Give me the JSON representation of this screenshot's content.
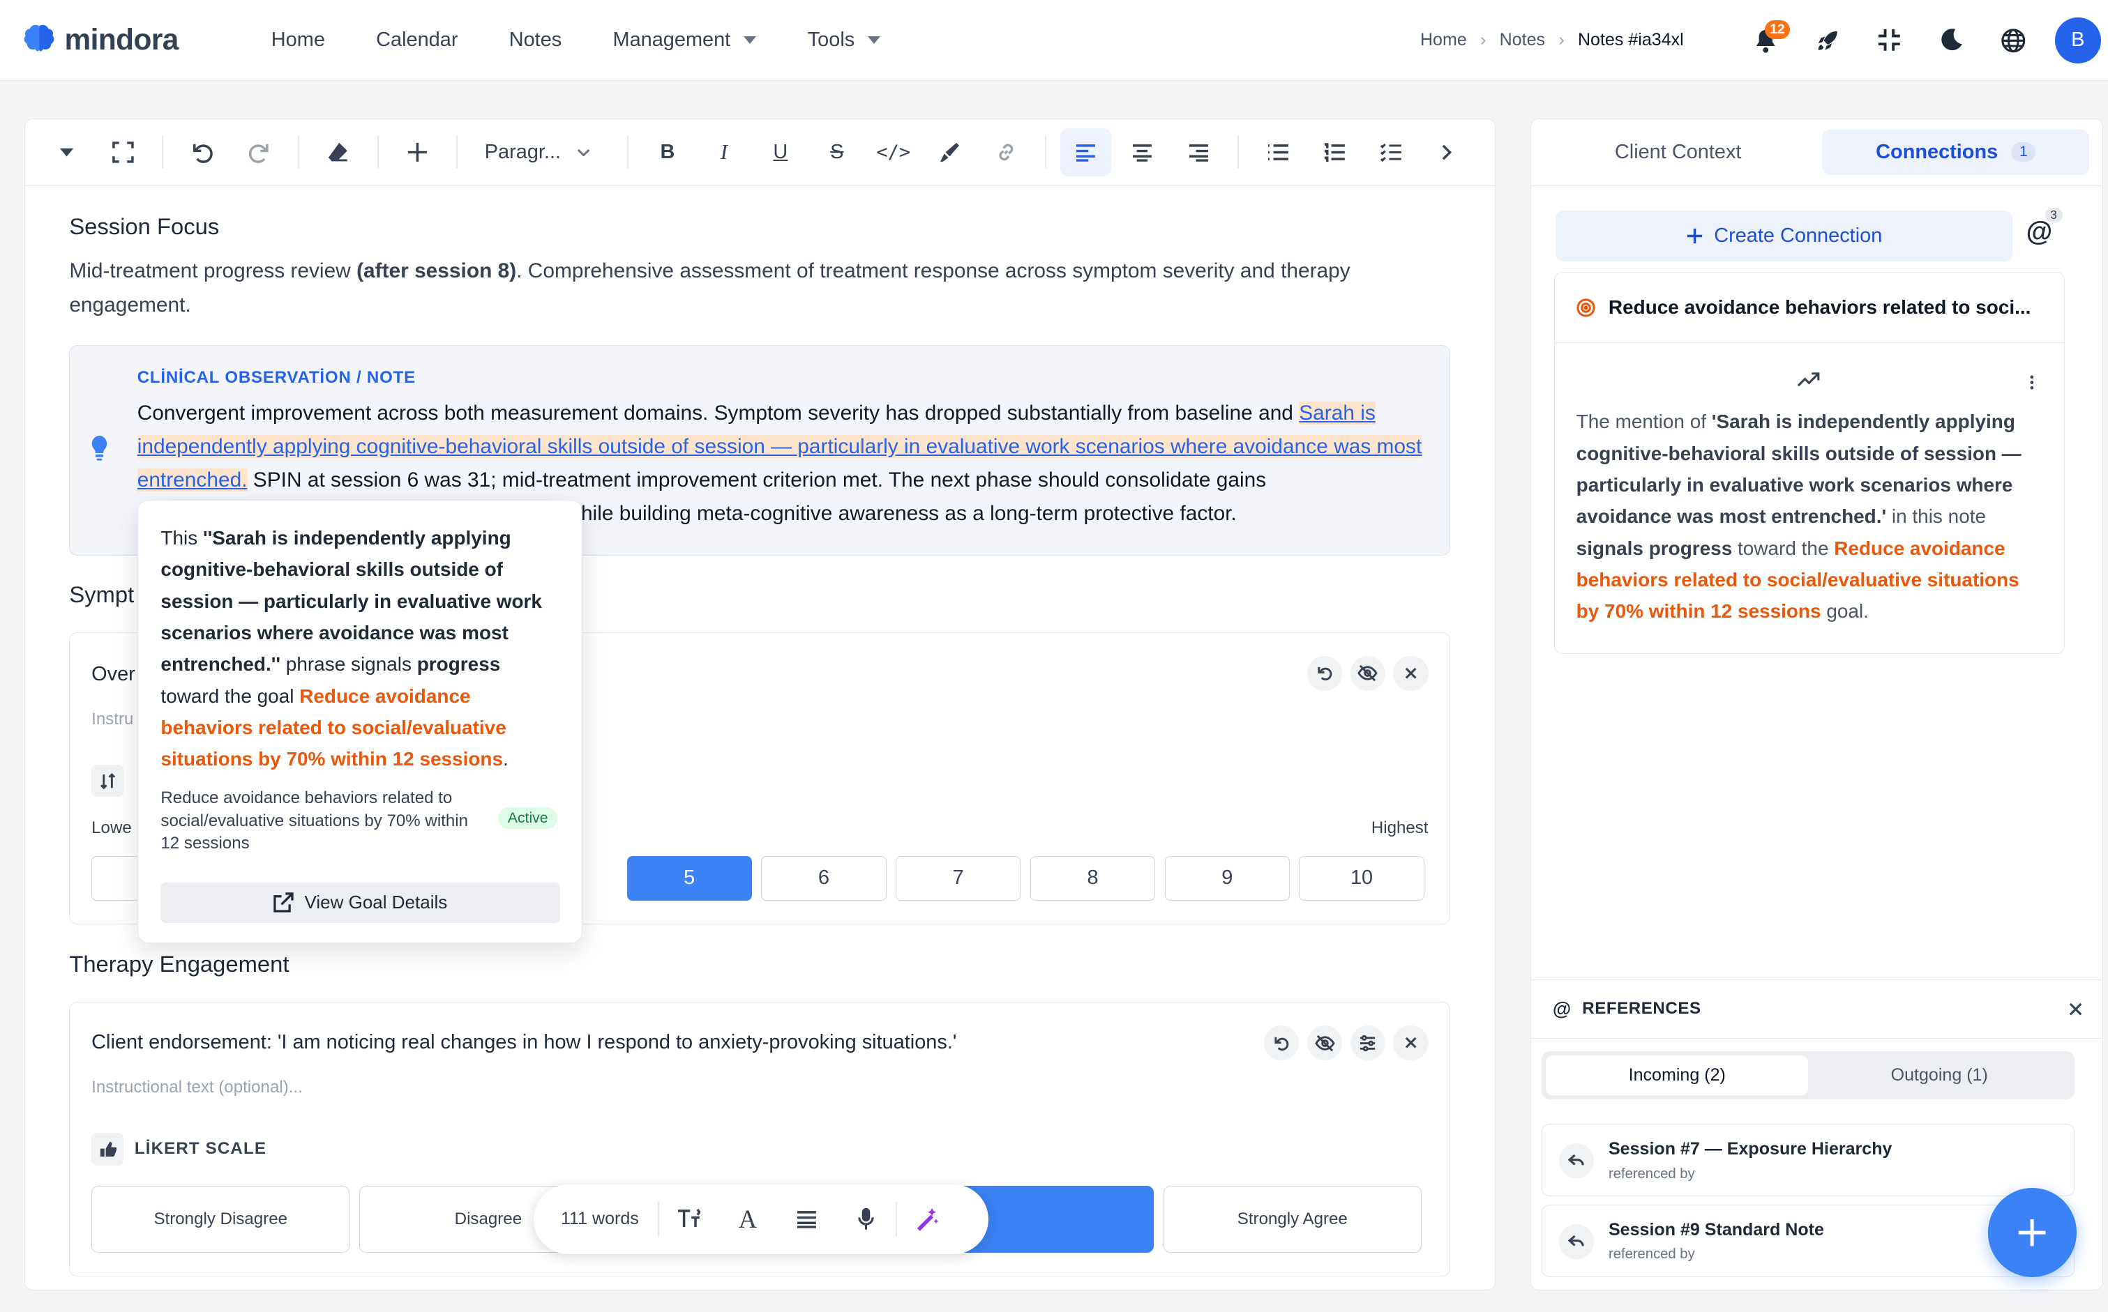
{
  "app": {
    "logo_text": "mindora"
  },
  "nav": [
    {
      "label": "Home"
    },
    {
      "label": "Calendar"
    },
    {
      "label": "Notes"
    },
    {
      "label": "Management",
      "dropdown": true
    },
    {
      "label": "Tools",
      "dropdown": true
    }
  ],
  "breadcrumb": [
    "Home",
    "Notes",
    "Notes #ia34xl"
  ],
  "header": {
    "notification_count": "12",
    "avatar_initial": "B"
  },
  "toolbar": {
    "paragraph_label": "Paragr..."
  },
  "editor": {
    "session_focus_title": "Session Focus",
    "session_focus_pre": "Mid-treatment progress review ",
    "session_focus_bold": "(after session 8)",
    "session_focus_post": ". Comprehensive assessment of treatment response across symptom severity and therapy engagement.",
    "observation": {
      "label": "CLİNİCAL OBSERVATİON / NOTE",
      "text_pre": "Convergent improvement across both measurement domains. Symptom severity has dropped substantially from baseline and ",
      "text_highlight": "Sarah is independently applying cognitive-behavioral skills outside of session — particularly in evaluative work scenarios where avoidance was most entrenched.",
      "text_post_1": " SPIN at session 6 was 31; mid-treatment improvement criterion met. The next phase should consolidate gains",
      "text_post_2": "hile building meta-cognitive awareness as a long-term protective factor."
    },
    "symptom_title_partial": "Sympt",
    "symptom_question_partial": "Over",
    "symptom_instruction_partial": "Instru",
    "scale_low_partial": "Lowe",
    "scale_high": "Highest",
    "scale_values": [
      "5",
      "6",
      "7",
      "8",
      "9",
      "10"
    ],
    "scale_selected": "5",
    "therapy_title": "Therapy Engagement",
    "therapy_question": "Client endorsement: 'I am noticing real changes in how I respond to anxiety-provoking situations.'",
    "therapy_instruction_placeholder": "Instructional text (optional)...",
    "likert_label": "LİKERT SCALE",
    "likert_options": [
      "Strongly Disagree",
      "Disagree",
      "Agree",
      "Strongly Agree"
    ],
    "likert_selected": "Agree"
  },
  "popover": {
    "prefix": "This ",
    "quote": "''Sarah is independently applying cognitive-behavioral skills outside of session — particularly in evaluative work scenarios where avoidance was most entrenched.''",
    "mid": " phrase signals ",
    "signal": "progress",
    "toward": " toward the goal ",
    "goal": "Reduce avoidance behaviors related to social/evaluative situations by 70% within 12 sessions",
    "end": ".",
    "goal_summary": "Reduce avoidance behaviors related to social/evaluative situations by 70% within 12 sessions",
    "status": "Active",
    "button": "View Goal Details"
  },
  "floating_bar": {
    "word_count": "111 words"
  },
  "right_panel": {
    "tabs": [
      {
        "label": "Client Context"
      },
      {
        "label": "Connections",
        "count": "1"
      }
    ],
    "create_connection": "Create Connection",
    "mention_count": "3",
    "connection": {
      "title": "Reduce avoidance behaviors related to soci...",
      "text_pre": "The mention of ",
      "quote": "'Sarah is independently applying cognitive-behavioral skills outside of session — particularly in evaluative work scenarios where avoidance was most entrenched.'",
      "text_mid": " in this note ",
      "signal": "signals progress",
      "toward": " toward the ",
      "goal": "Reduce avoidance behaviors related to social/evaluative situations by 70% within 12 sessions",
      "end": " goal."
    },
    "references": {
      "title": "REFERENCES",
      "incoming": "Incoming (2)",
      "outgoing": "Outgoing (1)",
      "items": [
        {
          "title": "Session #7 — Exposure Hierarchy",
          "sub": "referenced by"
        },
        {
          "title": "Session #9 Standard Note",
          "sub": "referenced by"
        }
      ]
    }
  },
  "colors": {
    "accent": "#3b82f6",
    "goal_orange": "#ea580c",
    "highlight": "#fde4cc"
  }
}
